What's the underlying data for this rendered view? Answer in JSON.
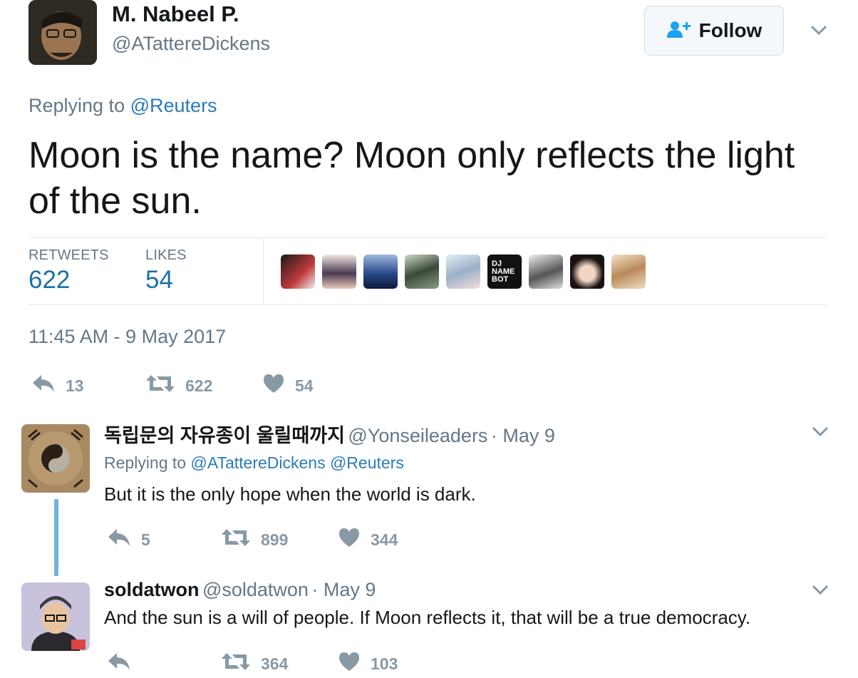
{
  "tweet": {
    "author_name": "M. Nabeel P.",
    "author_handle": "@ATattereDickens",
    "follow_label": "Follow",
    "replying_prefix": "Replying to",
    "replying_to": "@Reuters",
    "text": "Moon is the name? Moon only reflects the light of the sun.",
    "retweets_label": "RETWEETS",
    "retweets_count": "622",
    "likes_label": "LIKES",
    "likes_count": "54",
    "dj_badge": "DJ NAME BOT",
    "timestamp": "11:45 AM - 9 May 2017",
    "actions": {
      "replies": "13",
      "retweets": "622",
      "likes": "54"
    }
  },
  "replies": [
    {
      "name": "독립문의 자유종이 울릴때까지",
      "handle": "@Yonseileaders",
      "date": "· May 9",
      "replying_prefix": "Replying to",
      "replying_to": "@ATattereDickens @Reuters",
      "text": "But it is the only hope when the world is dark.",
      "actions": {
        "replies": "5",
        "retweets": "899",
        "likes": "344"
      }
    },
    {
      "name": "soldatwon",
      "handle": "@soldatwon",
      "date": "· May 9",
      "text": "And the sun is a will of people. If Moon reflects it, that will be a true democracy.",
      "actions": {
        "replies": "",
        "retweets": "364",
        "likes": "103"
      }
    }
  ],
  "colors": {
    "link": "#2b7bb9",
    "muted": "#657786",
    "icon": "#8899a6",
    "thread": "#6db4d8"
  }
}
